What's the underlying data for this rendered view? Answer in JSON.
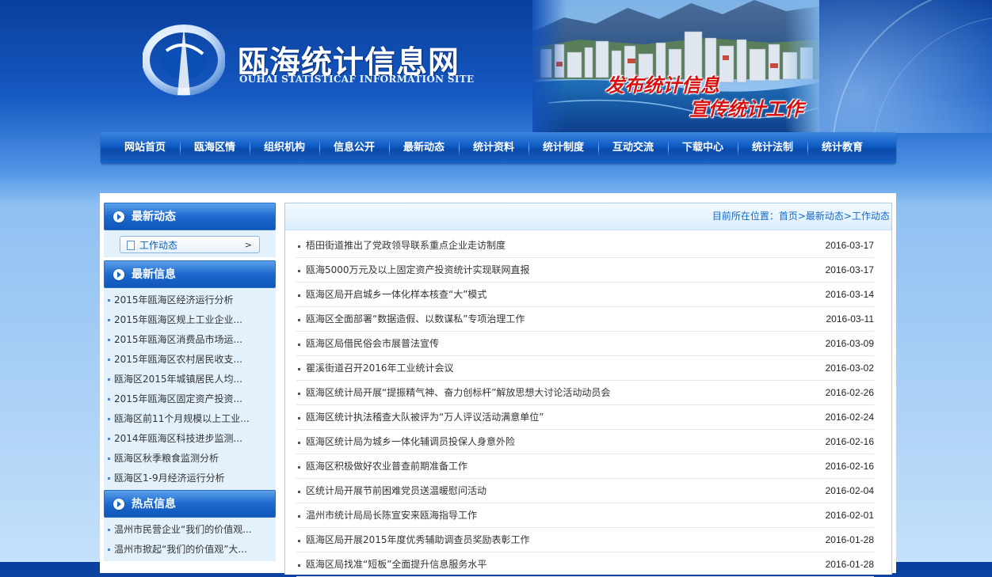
{
  "header": {
    "site_title": "瓯海统计信息网",
    "site_subtitle": "OUHAI STATISTICAF INFORMATION SITE",
    "slogan_line1": "发布统计信息",
    "slogan_line2": "宣传统计工作"
  },
  "nav": {
    "items": [
      "网站首页",
      "瓯海区情",
      "组织机构",
      "信息公开",
      "最新动态",
      "统计资料",
      "统计制度",
      "互动交流",
      "下载中心",
      "统计法制",
      "统计教育"
    ]
  },
  "sidebar": {
    "latest_news": {
      "title": "最新动态",
      "sub_item": "工作动态",
      "sub_arrow": ">"
    },
    "latest_info": {
      "title": "最新信息",
      "items": [
        "2015年瓯海区经济运行分析",
        "2015年瓯海区规上工业企业...",
        "2015年瓯海区消费品市场运...",
        "2015年瓯海区农村居民收支...",
        "瓯海区2015年城镇居民人均...",
        "2015年瓯海区固定资产投资...",
        "瓯海区前11个月规模以上工业...",
        "2014年瓯海区科技进步监测...",
        "瓯海区秋季粮食监测分析",
        "瓯海区1-9月经济运行分析"
      ]
    },
    "hot_info": {
      "title": "热点信息",
      "items": [
        "温州市民营企业“我们的价值观...",
        "温州市掀起“我们的价值观”大..."
      ]
    }
  },
  "breadcrumb": {
    "text": "目前所在位置：首页>最新动态>工作动态"
  },
  "news": [
    {
      "title": "梧田街道推出了党政领导联系重点企业走访制度",
      "date": "2016-03-17"
    },
    {
      "title": "瓯海5000万元及以上固定资产投资统计实现联网直报",
      "date": "2016-03-17"
    },
    {
      "title": "瓯海区局开启城乡一体化样本核查“大”模式",
      "date": "2016-03-14"
    },
    {
      "title": "瓯海区全面部署“数据造假、以数谋私”专项治理工作",
      "date": "2016-03-11"
    },
    {
      "title": "瓯海区局借民俗会市展普法宣传",
      "date": "2016-03-09"
    },
    {
      "title": "瞿溪街道召开2016年工业统计会议",
      "date": "2016-03-02"
    },
    {
      "title": "瓯海区统计局开展“提振精气神、奋力创标杆”解放思想大讨论活动动员会",
      "date": "2016-02-26"
    },
    {
      "title": "瓯海区统计执法稽查大队被评为“万人评议活动满意单位”",
      "date": "2016-02-24"
    },
    {
      "title": "瓯海区统计局为城乡一体化辅调员投保人身意外险",
      "date": "2016-02-16"
    },
    {
      "title": "瓯海区积极做好农业普查前期准备工作",
      "date": "2016-02-16"
    },
    {
      "title": "区统计局开展节前困难党员送温暖慰问活动",
      "date": "2016-02-04"
    },
    {
      "title": "温州市统计局局长陈宣安来瓯海指导工作",
      "date": "2016-02-01"
    },
    {
      "title": "瓯海区局开展2015年度优秀辅助调查员奖励表彰工作",
      "date": "2016-01-28"
    },
    {
      "title": "瓯海区局找准“短板”全面提升信息服务水平",
      "date": "2016-01-28"
    }
  ]
}
